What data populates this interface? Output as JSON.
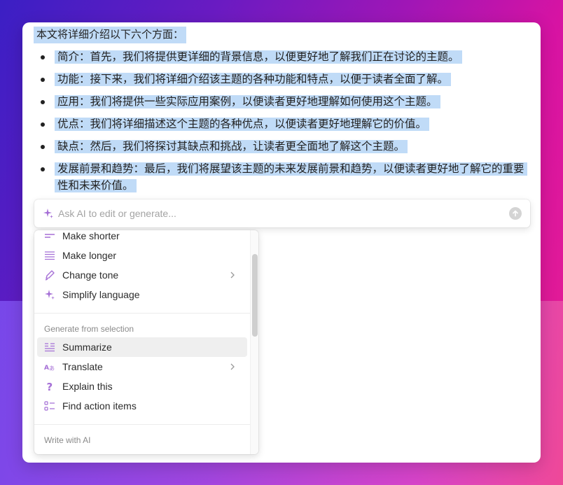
{
  "document": {
    "intro": "本文将详细介绍以下六个方面：",
    "points": [
      "简介：首先，我们将提供更详细的背景信息，以便更好地了解我们正在讨论的主题。",
      "功能：接下来，我们将详细介绍该主题的各种功能和特点，以便于读者全面了解。",
      "应用：我们将提供一些实际应用案例，以便读者更好地理解如何使用这个主题。",
      "优点：我们将详细描述这个主题的各种优点，以便读者更好地理解它的价值。",
      "缺点：然后，我们将探讨其缺点和挑战，让读者更全面地了解这个主题。",
      "发展前景和趋势：最后，我们将展望该主题的未来发展前景和趋势，以便读者更好地了解它的重要性和未来价值。"
    ]
  },
  "ai_bar": {
    "placeholder": "Ask AI to edit or generate...",
    "value": ""
  },
  "menu": {
    "edit_items": [
      {
        "label": "Make shorter",
        "icon": "short-lines-icon"
      },
      {
        "label": "Make longer",
        "icon": "long-lines-icon"
      },
      {
        "label": "Change tone",
        "icon": "pen-icon",
        "submenu": true
      },
      {
        "label": "Simplify language",
        "icon": "sparkle-icon"
      }
    ],
    "generate_section": "Generate from selection",
    "generate_items": [
      {
        "label": "Summarize",
        "icon": "summarize-icon",
        "active": true
      },
      {
        "label": "Translate",
        "icon": "translate-icon",
        "submenu": true
      },
      {
        "label": "Explain this",
        "icon": "question-icon"
      },
      {
        "label": "Find action items",
        "icon": "checklist-icon"
      }
    ],
    "write_section": "Write with AI"
  },
  "colors": {
    "accent": "#a56fd6",
    "selection": "#c0dbf7"
  }
}
